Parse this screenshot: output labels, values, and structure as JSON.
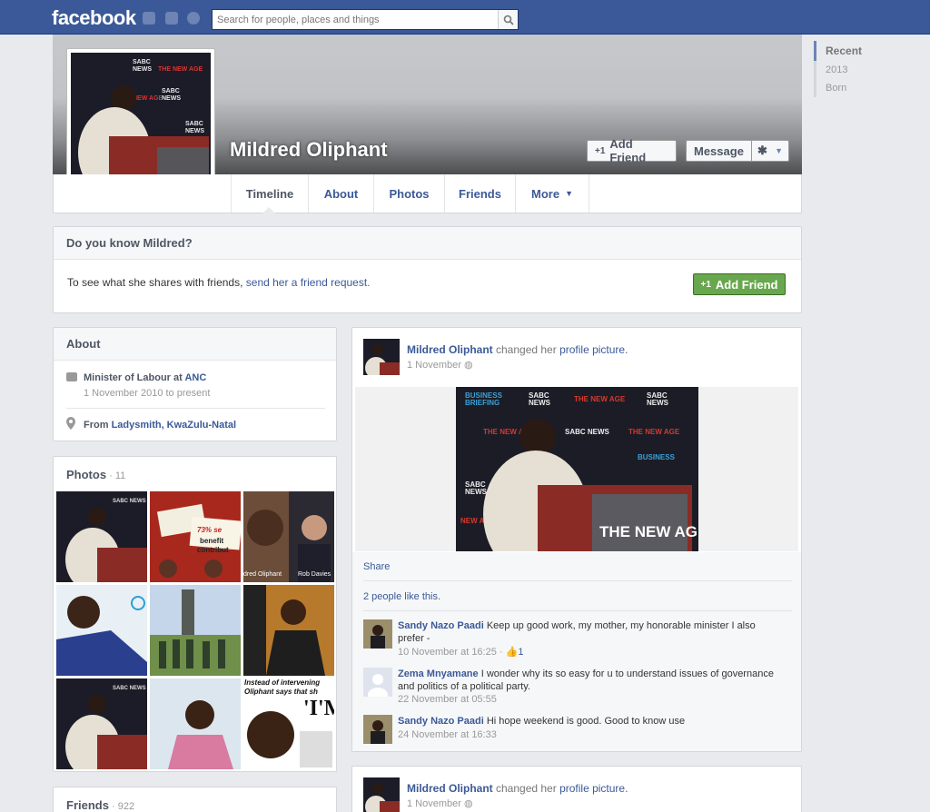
{
  "topbar": {
    "logo": "facebook",
    "search_placeholder": "Search for people, places and things"
  },
  "profile": {
    "name": "Mildred Oliphant",
    "add_friend": "Add Friend",
    "message": "Message"
  },
  "tabs": [
    "Timeline",
    "About",
    "Photos",
    "Friends",
    "More"
  ],
  "know": {
    "title": "Do you know Mildred?",
    "text": "To see what she shares with friends, ",
    "link": "send her a friend request.",
    "button": "Add Friend"
  },
  "about": {
    "title": "About",
    "job": "Minister of Labour at ",
    "job_link": "ANC",
    "job_dates": "1 November 2010 to present",
    "from": "From ",
    "from_link": "Ladysmith, KwaZulu-Natal"
  },
  "photos": {
    "title": "Photos",
    "count": "11",
    "captions": [
      "dred Oliphant",
      "Rob Davies"
    ],
    "headline1": "Instead of intervening",
    "headline2": "Oliphant says that sh",
    "headline3": "'I'M",
    "sign1": "benefit",
    "sign2": "contribut",
    "sign3": "73% se"
  },
  "friends": {
    "title": "Friends",
    "count": "922"
  },
  "timeline_nav": [
    "Recent",
    "2013",
    "Born"
  ],
  "post1": {
    "author": "Mildred Oliphant",
    "action": " changed her ",
    "action_link": "profile picture.",
    "date": "1 November",
    "share": "Share",
    "likes": "2 people like this."
  },
  "comments": [
    {
      "name": "Sandy Nazo Paadi",
      "text": " Keep up good work, my mother, my honorable minister I also prefer -",
      "meta": "10 November at 16:25",
      "likes": "1"
    },
    {
      "name": "Zema Mnyamane",
      "text": " I wonder why its so easy for u to understand issues of governance and politics of a political party.",
      "meta": "22 November at 05:55"
    },
    {
      "name": "Sandy Nazo Paadi",
      "text": " Hi hope weekend is good. Good to know use",
      "meta": "24 November at 16:33"
    }
  ],
  "post2": {
    "author": "Mildred Oliphant",
    "action": " changed her ",
    "action_link": "profile picture.",
    "date": "1 November"
  },
  "backdrop": {
    "brand1": "SABC",
    "brand2": "NEWS",
    "brand3": "THE NEW AGE",
    "brand4": "BUSINESS",
    "brand5": "BRIEFING",
    "podium": "THE NEW AGE"
  },
  "colors": {
    "fb_blue": "#3b5998",
    "green": "#69a74e"
  }
}
